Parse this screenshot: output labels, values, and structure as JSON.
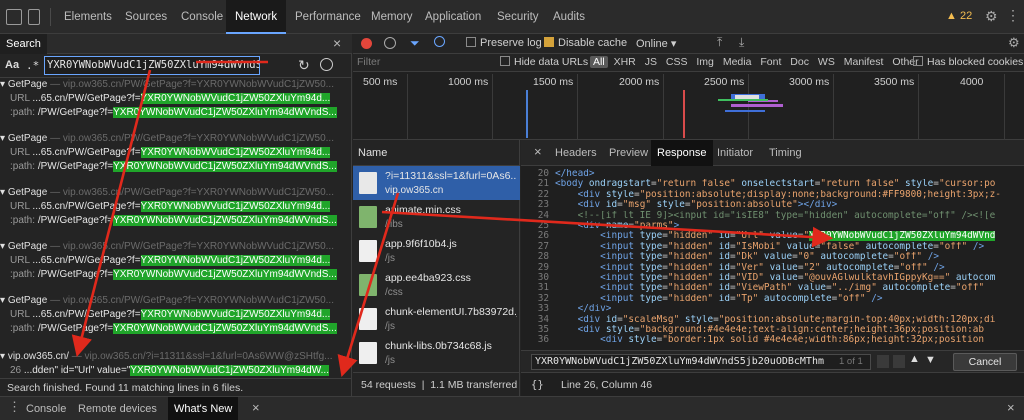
{
  "toolbar": {
    "tabs": [
      "Elements",
      "Sources",
      "Console",
      "Network",
      "Performance",
      "Memory",
      "Application",
      "Security",
      "Audits"
    ],
    "active_tab": "Network",
    "warning_count": "22"
  },
  "search": {
    "panel_label": "Search",
    "case_label": "Aa",
    "regex_label": ".*",
    "query": "YXR0YWNobWVudC1jZW50ZXluYm94dWVndS",
    "results": [
      {
        "file": "GetPage",
        "url": "— vip.ow365.cn/PW/GetPage?f=YXR0YWNobWVudC1jZW50...",
        "lines": [
          {
            "label": "URL",
            "pre": "...65.cn/PW/GetPage?f=",
            "match": "YXR0YWNobWVudC1jZW50ZXluYm94d..."
          },
          {
            "label": ":path:",
            "pre": "/PW/GetPage?f=",
            "match": "YXR0YWNobWVudC1jZW50ZXluYm94dWVndS..."
          }
        ]
      },
      {
        "file": "GetPage",
        "url": "— vip.ow365.cn/PW/GetPage?f=YXR0YWNobWVudC1jZW50...",
        "lines": [
          {
            "label": "URL",
            "pre": "...65.cn/PW/GetPage?f=",
            "match": "YXR0YWNobWVudC1jZW50ZXluYm94d..."
          },
          {
            "label": ":path:",
            "pre": "/PW/GetPage?f=",
            "match": "YXR0YWNobWVudC1jZW50ZXluYm94dWVndS..."
          }
        ]
      },
      {
        "file": "GetPage",
        "url": "— vip.ow365.cn/PW/GetPage?f=YXR0YWNobWVudC1jZW50...",
        "lines": [
          {
            "label": "URL",
            "pre": "...65.cn/PW/GetPage?f=",
            "match": "YXR0YWNobWVudC1jZW50ZXluYm94d..."
          },
          {
            "label": ":path:",
            "pre": "/PW/GetPage?f=",
            "match": "YXR0YWNobWVudC1jZW50ZXluYm94dWVndS..."
          }
        ]
      },
      {
        "file": "GetPage",
        "url": "— vip.ow365.cn/PW/GetPage?f=YXR0YWNobWVudC1jZW50...",
        "lines": [
          {
            "label": "URL",
            "pre": "...65.cn/PW/GetPage?f=",
            "match": "YXR0YWNobWVudC1jZW50ZXluYm94d..."
          },
          {
            "label": ":path:",
            "pre": "/PW/GetPage?f=",
            "match": "YXR0YWNobWVudC1jZW50ZXluYm94dWVndS..."
          }
        ]
      },
      {
        "file": "GetPage",
        "url": "— vip.ow365.cn/PW/GetPage?f=YXR0YWNobWVudC1jZW50...",
        "lines": [
          {
            "label": "URL",
            "pre": "...65.cn/PW/GetPage?f=",
            "match": "YXR0YWNobWVudC1jZW50ZXluYm94d..."
          },
          {
            "label": ":path:",
            "pre": "/PW/GetPage?f=",
            "match": "YXR0YWNobWVudC1jZW50ZXluYm94dWVndS..."
          }
        ]
      },
      {
        "file": "vip.ow365.cn/",
        "url": "— vip.ow365.cn/?i=11311&ssl=1&furl=0As6WW@zSHtfg...",
        "lines": [
          {
            "label": "26",
            "pre": "...dden\" id=\"Url\" value=\"",
            "match": "YXR0YWNobWVudC1jZW50ZXluYm94dW..."
          }
        ]
      }
    ],
    "status": "Search finished.  Found 11 matching lines in 6 files."
  },
  "network": {
    "preserve_log": "Preserve log",
    "disable_cache": "Disable cache",
    "throttle": "Online",
    "filter_placeholder": "Filter",
    "hide_data_urls": "Hide data URLs",
    "types": [
      "All",
      "XHR",
      "JS",
      "CSS",
      "Img",
      "Media",
      "Font",
      "Doc",
      "WS",
      "Manifest",
      "Other"
    ],
    "blocked_cookies": "Has blocked cookies",
    "timeline_ticks": [
      "500 ms",
      "1000 ms",
      "1500 ms",
      "2000 ms",
      "2500 ms",
      "3000 ms",
      "3500 ms",
      "4000"
    ],
    "name_header": "Name",
    "requests": [
      {
        "name": "?i=11311&ssl=1&furl=0As6...",
        "path": "vip.ow365.cn",
        "type": "doc",
        "selected": true
      },
      {
        "name": "animate.min.css",
        "path": "/libs",
        "type": "css",
        "selected": false
      },
      {
        "name": "app.9f6f10b4.js",
        "path": "/js",
        "type": "js",
        "selected": false
      },
      {
        "name": "app.ee4ba923.css",
        "path": "/css",
        "type": "css",
        "selected": false
      },
      {
        "name": "chunk-elementUI.7b83972d.js",
        "path": "/js",
        "type": "js",
        "selected": false
      },
      {
        "name": "chunk-libs.0b734c68.js",
        "path": "/js",
        "type": "js",
        "selected": false
      }
    ],
    "summary_requests": "54 requests",
    "summary_transferred": "1.1 MB transferred"
  },
  "detail": {
    "tabs": [
      "Headers",
      "Preview",
      "Response",
      "Initiator",
      "Timing"
    ],
    "active_tab": "Response",
    "find_query": "YXR0YWNobWVudC1jZW50ZXluYm94dWVndS5jb20uODBcMThm",
    "find_count": "1 of 1",
    "cancel_label": "Cancel",
    "cursor_pos": "Line 26, Column 46",
    "code": [
      {
        "n": "20",
        "html": "<span class='tag'>&lt;/head&gt;</span>"
      },
      {
        "n": "21",
        "html": "<span class='tag'>&lt;body</span> <span class='attr'>ondragstart</span>=<span class='str'>\"return false\"</span> <span class='attr'>onselectstart</span>=<span class='str'>\"return false\"</span> <span class='attr'>style</span>=<span class='str'>\"cursor:po</span>"
      },
      {
        "n": "22",
        "html": "    <span class='tag'>&lt;div</span> <span class='attr'>style</span>=<span class='str'>\"position:absolute;display:none;background:#FF9800;height:3px;z-</span>"
      },
      {
        "n": "23",
        "html": "    <span class='tag'>&lt;div</span> <span class='attr'>id</span>=<span class='str'>\"msg\"</span> <span class='attr'>style</span>=<span class='str'>\"position:absolute\"</span><span class='tag'>&gt;&lt;/div&gt;</span>"
      },
      {
        "n": "24",
        "html": "    <span class='cmt'>&lt;!--[if lt IE 9]&gt;&lt;input id=\"isIE8\" type=\"hidden\" autocomplete=\"off\" /&gt;&lt;![e</span>"
      },
      {
        "n": "25",
        "html": "    <span class='tag'>&lt;div</span> <span class='attr'>name</span>=<span class='str'>\"parms\"</span><span class='tag'>&gt;</span>"
      },
      {
        "n": "26",
        "html": "        <span class='tag'>&lt;input</span> <span class='attr'>type</span>=<span class='str'>\"hidden\"</span> <span class='attr'>id</span>=<span class='str'>\"Url\"</span> <span class='attr'>value</span>=<span class='str'>\"</span><span class='hl'>YXR0YWNobWVudC1jZW50ZXluYm94dWVnd</span>"
      },
      {
        "n": "27",
        "html": "        <span class='tag'>&lt;input</span> <span class='attr'>type</span>=<span class='str'>\"hidden\"</span> <span class='attr'>id</span>=<span class='str'>\"IsMobi\"</span> <span class='attr'>value</span>=<span class='str'>\"false\"</span> <span class='attr'>autocomplete</span>=<span class='str'>\"off\"</span> <span class='tag'>/&gt;</span>"
      },
      {
        "n": "28",
        "html": "        <span class='tag'>&lt;input</span> <span class='attr'>type</span>=<span class='str'>\"hidden\"</span> <span class='attr'>id</span>=<span class='str'>\"Dk\"</span> <span class='attr'>value</span>=<span class='str'>\"0\"</span> <span class='attr'>autocomplete</span>=<span class='str'>\"off\"</span> <span class='tag'>/&gt;</span>"
      },
      {
        "n": "29",
        "html": "        <span class='tag'>&lt;input</span> <span class='attr'>type</span>=<span class='str'>\"hidden\"</span> <span class='attr'>id</span>=<span class='str'>\"Ver\"</span> <span class='attr'>value</span>=<span class='str'>\"2\"</span> <span class='attr'>autocomplete</span>=<span class='str'>\"off\"</span> <span class='tag'>/&gt;</span>"
      },
      {
        "n": "30",
        "html": "        <span class='tag'>&lt;input</span> <span class='attr'>type</span>=<span class='str'>\"hidden\"</span> <span class='attr'>id</span>=<span class='str'>\"VID\"</span> <span class='attr'>value</span>=<span class='str'>\"@ouvAGlwulktavhIGppyKg==\"</span> <span class='attr'>autocom</span>"
      },
      {
        "n": "31",
        "html": "        <span class='tag'>&lt;input</span> <span class='attr'>type</span>=<span class='str'>\"hidden\"</span> <span class='attr'>id</span>=<span class='str'>\"ViewPath\"</span> <span class='attr'>value</span>=<span class='str'>\"../img\"</span> <span class='attr'>autocomplete</span>=<span class='str'>\"off\"</span></span>"
      },
      {
        "n": "32",
        "html": "        <span class='tag'>&lt;input</span> <span class='attr'>type</span>=<span class='str'>\"hidden\"</span> <span class='attr'>id</span>=<span class='str'>\"Tp\"</span> <span class='attr'>autocomplete</span>=<span class='str'>\"off\"</span> <span class='tag'>/&gt;</span>"
      },
      {
        "n": "33",
        "html": "    <span class='tag'>&lt;/div&gt;</span>"
      },
      {
        "n": "34",
        "html": "    <span class='tag'>&lt;div</span> <span class='attr'>id</span>=<span class='str'>\"scaleMsg\"</span> <span class='attr'>style</span>=<span class='str'>\"position:absolute;margin-top:40px;width:120px;di</span>"
      },
      {
        "n": "35",
        "html": "    <span class='tag'>&lt;div</span> <span class='attr'>style</span>=<span class='str'>\"background:#4e4e4e;text-align:center;height:36px;position:ab</span>"
      },
      {
        "n": "36",
        "html": "        <span class='tag'>&lt;div</span> <span class='attr'>style</span>=<span class='str'>\"border:1px solid #4e4e4e;width:86px;height:32px;position</span>"
      }
    ]
  },
  "drawer": {
    "tabs": [
      "Console",
      "Remote devices",
      "What's New"
    ],
    "active_tab": "What's New"
  },
  "colors": {
    "accent": "#6aa6ff",
    "match": "#20a52a",
    "selected_row": "#2f5fa8",
    "annotation": "#e0291c"
  }
}
